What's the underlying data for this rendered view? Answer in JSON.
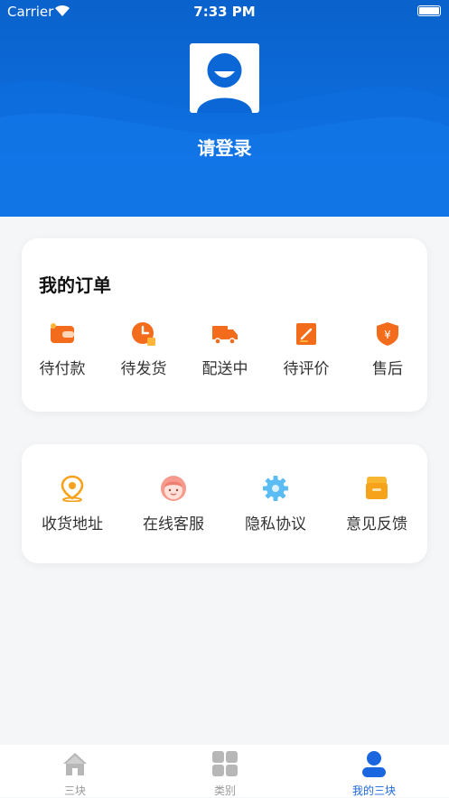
{
  "status_bar": {
    "carrier": "Carrier",
    "time": "7:33 PM"
  },
  "profile": {
    "login_label": "请登录"
  },
  "orders": {
    "title": "我的订单",
    "items": [
      {
        "label": "待付款",
        "icon": "wallet-icon"
      },
      {
        "label": "待发货",
        "icon": "clock-icon"
      },
      {
        "label": "配送中",
        "icon": "truck-icon"
      },
      {
        "label": "待评价",
        "icon": "edit-icon"
      },
      {
        "label": "售后",
        "icon": "yuan-shield-icon"
      }
    ]
  },
  "services": {
    "items": [
      {
        "label": "收货地址",
        "icon": "location-pin-icon"
      },
      {
        "label": "在线客服",
        "icon": "customer-service-icon"
      },
      {
        "label": "隐私协议",
        "icon": "gear-icon"
      },
      {
        "label": "意见反馈",
        "icon": "feedback-box-icon"
      }
    ]
  },
  "tabbar": {
    "items": [
      {
        "label": "三块",
        "icon": "home-icon",
        "active": false
      },
      {
        "label": "类别",
        "icon": "grid-icon",
        "active": false
      },
      {
        "label": "我的三块",
        "icon": "person-icon",
        "active": true
      }
    ]
  },
  "colors": {
    "header_blue": "#0c6ad8",
    "accent_orange": "#f36c1c",
    "active_tab": "#1a66e0",
    "inactive_tab": "#999999"
  }
}
